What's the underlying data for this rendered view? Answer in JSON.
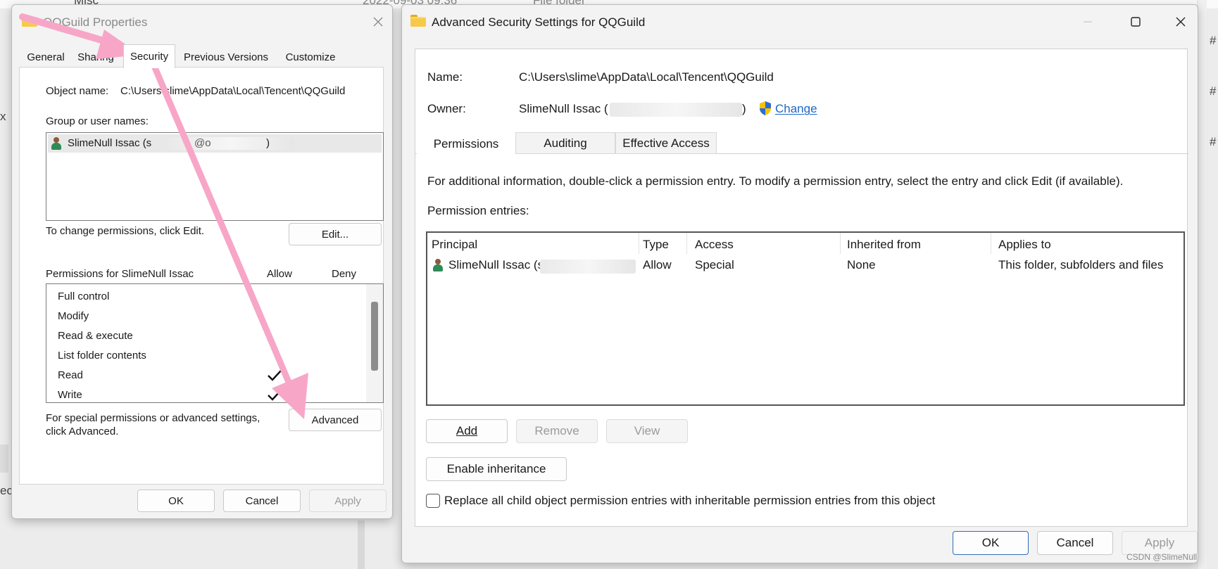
{
  "background": {
    "explorer_row_name": "Misc",
    "explorer_row_date": "2022-09-03 09:36",
    "explorer_row_type": "File folder",
    "edge_text_left_1": "x",
    "edge_text_left_2": "ect",
    "edge_marks_right": [
      "#",
      "#",
      "#"
    ]
  },
  "props_window": {
    "title": "QQGuild Properties",
    "tabs": [
      "General",
      "Sharing",
      "Security",
      "Previous Versions",
      "Customize"
    ],
    "active_tab": "Security",
    "object_name_label": "Object name:",
    "object_name_value": "C:\\Users\\slime\\AppData\\Local\\Tencent\\QQGuild",
    "group_label": "Group or user names:",
    "users": [
      {
        "name": "SlimeNull Issac (s",
        "mid": "@o",
        "end": ")"
      }
    ],
    "change_perm_text": "To change permissions, click Edit.",
    "edit_button": "Edit...",
    "permissions_for": "Permissions for SlimeNull Issac",
    "allow_header": "Allow",
    "deny_header": "Deny",
    "permissions": [
      {
        "name": "Full control",
        "allow": false,
        "deny": false
      },
      {
        "name": "Modify",
        "allow": false,
        "deny": false
      },
      {
        "name": "Read & execute",
        "allow": false,
        "deny": false
      },
      {
        "name": "List folder contents",
        "allow": false,
        "deny": false
      },
      {
        "name": "Read",
        "allow": true,
        "deny": false
      },
      {
        "name": "Write",
        "allow": true,
        "deny": false
      }
    ],
    "special_text_1": "For special permissions or advanced settings,",
    "special_text_2": "click Advanced.",
    "advanced_button": "Advanced",
    "ok_button": "OK",
    "cancel_button": "Cancel",
    "apply_button": "Apply"
  },
  "adv_window": {
    "title": "Advanced Security Settings for QQGuild",
    "name_label": "Name:",
    "name_value": "C:\\Users\\slime\\AppData\\Local\\Tencent\\QQGuild",
    "owner_label": "Owner:",
    "owner_value_start": "SlimeNull Issac (",
    "owner_value_end": ")",
    "change_link": "Change",
    "tabs": [
      "Permissions",
      "Auditing",
      "Effective Access"
    ],
    "active_tab": "Permissions",
    "info_text": "For additional information, double-click a permission entry. To modify a permission entry, select the entry and click Edit (if available).",
    "entries_label": "Permission entries:",
    "columns": [
      "Principal",
      "Type",
      "Access",
      "Inherited from",
      "Applies to"
    ],
    "entries": [
      {
        "principal": "SlimeNull Issac (s",
        "type": "Allow",
        "access": "Special",
        "inherited_from": "None",
        "applies_to": "This folder, subfolders and files"
      }
    ],
    "add_button": "Add",
    "remove_button": "Remove",
    "view_button": "View",
    "enable_inheritance_button": "Enable inheritance",
    "replace_checkbox_label": "Replace all child object permission entries with inheritable permission entries from this object",
    "replace_checked": false,
    "ok_button": "OK",
    "cancel_button": "Cancel",
    "apply_button": "Apply"
  },
  "annotation_color": "#f7a6c8",
  "watermark": "CSDN @SlimeNull"
}
